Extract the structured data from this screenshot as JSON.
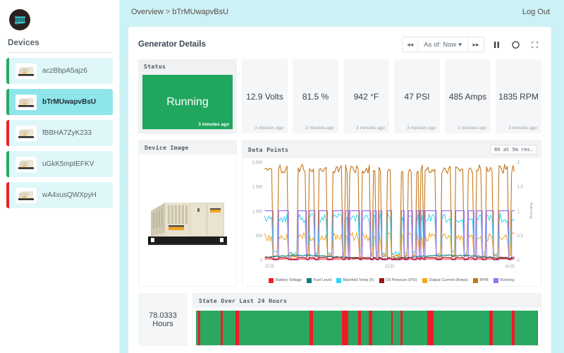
{
  "brand": {
    "logo_icon": "dam-logo-icon"
  },
  "sidebar": {
    "title": "Devices",
    "items": [
      {
        "label": "aczBbpA5ajz6",
        "status_color": "#2aa862",
        "selected": false
      },
      {
        "label": "bTrMUwapvBsU",
        "status_color": "#2aa862",
        "selected": true
      },
      {
        "label": "fBBHA7ZyK233",
        "status_color": "#e8232a",
        "selected": false
      },
      {
        "label": "uGkK5mptEFKV",
        "status_color": "#2aa862",
        "selected": false
      },
      {
        "label": "wA4xusQWXpyH",
        "status_color": "#e8232a",
        "selected": false
      }
    ]
  },
  "header": {
    "breadcrumb_root": "Overview",
    "breadcrumb_sep": ">",
    "breadcrumb_current": "bTrMUwapvBsU",
    "logout_label": "Log Out"
  },
  "panel": {
    "title": "Generator Details",
    "toolbar": {
      "rewind_label": "◂◂",
      "asof_label": "As of: Now",
      "asof_caret": "▾",
      "forward_label": "▸▸",
      "pause_icon": "pause-icon",
      "refresh_icon": "circle-icon",
      "fullscreen_icon": "expand-icon"
    }
  },
  "status_card": {
    "header": "Status",
    "value": "Running",
    "timestamp": "3 minutes ago",
    "color": "#21a65f"
  },
  "metrics": [
    {
      "value": "12.9 Volts",
      "timestamp": "3 minutes ago"
    },
    {
      "value": "81.5 %",
      "timestamp": "3 minutes ago"
    },
    {
      "value": "942 °F",
      "timestamp": "3 minutes ago"
    },
    {
      "value": "47 PSI",
      "timestamp": "3 minutes ago"
    },
    {
      "value": "485 Amps",
      "timestamp": "3 minutes ago"
    },
    {
      "value": "1835 RPM",
      "timestamp": "3 minutes ago"
    }
  ],
  "device_image": {
    "header": "Device Image",
    "alt": "generator-photo"
  },
  "data_points": {
    "header": "Data Points",
    "resolution_label": "6h at 5m res."
  },
  "state_card": {
    "header": "State Over Last 24 Hours",
    "running_color": "#2aa862",
    "stopped_color": "#ed1c24"
  },
  "hours_card": {
    "value": "78.0333",
    "unit": "Hours"
  },
  "chart_data": {
    "type": "line",
    "title": "Data Points",
    "xlabel": "",
    "ylabel": "",
    "y2label": "Running",
    "grid": false,
    "legend_position": "bottom",
    "x_ticks": [
      "10:25",
      "13:30",
      "16:25"
    ],
    "y_ticks": [
      "0",
      "500",
      "1,000",
      "1,500",
      "2,000"
    ],
    "ylim": [
      0,
      2000
    ],
    "y2_ticks": [
      "0",
      "0.5",
      "1",
      "1.5",
      "2"
    ],
    "y2lim": [
      0,
      2
    ],
    "series": [
      {
        "name": "Battery Voltage",
        "color": "#f42026",
        "axis": "left",
        "nominal": 13
      },
      {
        "name": "Fuel Level",
        "color": "#0d7f82",
        "axis": "left",
        "nominal": 81
      },
      {
        "name": "Manifold Temp (F)",
        "color": "#2fd8f7",
        "axis": "left",
        "nominal": 900
      },
      {
        "name": "Oil Pressure (PSI)",
        "color": "#9c1114",
        "axis": "left",
        "nominal": 47
      },
      {
        "name": "Output Current (Amps)",
        "color": "#f5a623",
        "axis": "left",
        "nominal": 485
      },
      {
        "name": "RPM",
        "color": "#c2761b",
        "axis": "left",
        "nominal": 1835
      },
      {
        "name": "Running",
        "color": "#9b6ef3",
        "axis": "right",
        "nominal": 1
      }
    ]
  }
}
